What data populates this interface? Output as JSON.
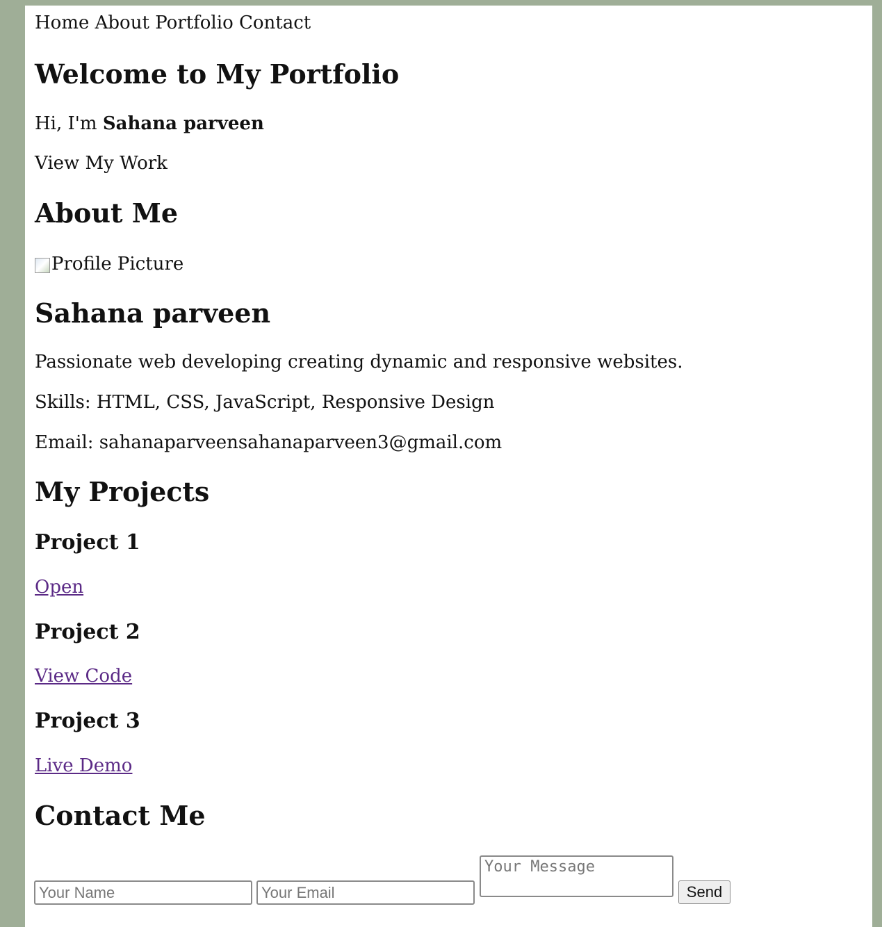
{
  "nav": {
    "items": [
      "Home",
      "About",
      "Portfolio",
      "Contact"
    ]
  },
  "hero": {
    "title": "Welcome to My Portfolio",
    "greeting_prefix": "Hi, I'm ",
    "greeting_name": "Sahana parveen",
    "cta": "View My Work"
  },
  "about": {
    "heading": "About Me",
    "image_alt": "Profile Picture",
    "name": "Sahana parveen",
    "bio": "Passionate web developing creating dynamic and responsive websites.",
    "skills": "Skills: HTML, CSS, JavaScript, Responsive Design",
    "email": "Email: sahanaparveensahanaparveen3@gmail.com"
  },
  "projects": {
    "heading": "My Projects",
    "items": [
      {
        "title": "Project 1",
        "link": "Open"
      },
      {
        "title": "Project 2",
        "link": "View Code"
      },
      {
        "title": "Project 3",
        "link": "Live Demo"
      }
    ]
  },
  "contact": {
    "heading": "Contact Me",
    "name_placeholder": "Your Name",
    "email_placeholder": "Your Email",
    "message_placeholder": "Your Message",
    "send_label": "Send"
  },
  "colors": {
    "background": "#9fae97",
    "page": "#ffffff",
    "link": "#5b2a86"
  }
}
